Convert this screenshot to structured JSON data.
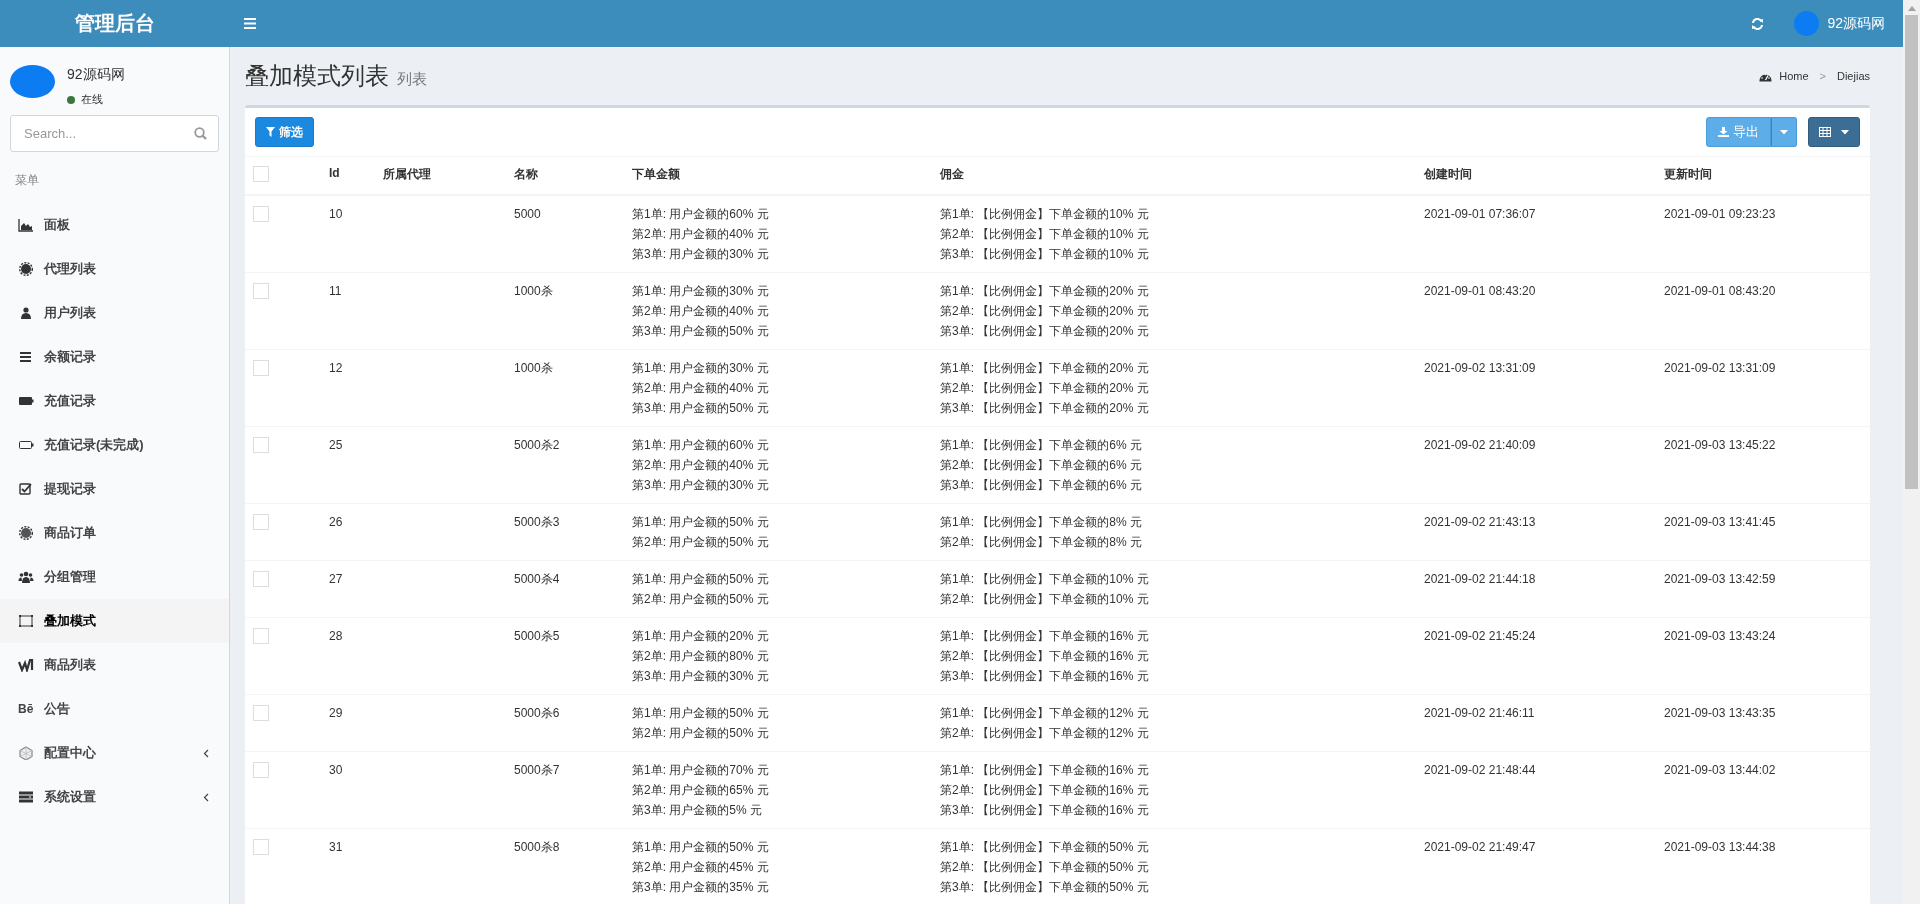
{
  "header": {
    "brand": "管理后台",
    "user_name": "92源码网"
  },
  "sidebar": {
    "user": {
      "name": "92源码网",
      "status": "在线"
    },
    "search": {
      "placeholder": "Search..."
    },
    "section_label": "菜单",
    "items": [
      {
        "label": "面板",
        "kind": "link",
        "selected": false
      },
      {
        "label": "代理列表",
        "kind": "link",
        "selected": false
      },
      {
        "label": "用户列表",
        "kind": "link",
        "selected": false
      },
      {
        "label": "余额记录",
        "kind": "link",
        "selected": false
      },
      {
        "label": "充值记录",
        "kind": "link",
        "selected": false
      },
      {
        "label": "充值记录(未完成)",
        "kind": "link",
        "selected": false
      },
      {
        "label": "提现记录",
        "kind": "link",
        "selected": false
      },
      {
        "label": "商品订单",
        "kind": "link",
        "selected": false
      },
      {
        "label": "分组管理",
        "kind": "link",
        "selected": false
      },
      {
        "label": "叠加模式",
        "kind": "link",
        "selected": true
      },
      {
        "label": "商品列表",
        "kind": "link",
        "selected": false
      },
      {
        "label": "公告",
        "kind": "link",
        "selected": false,
        "glyph": "Bē"
      },
      {
        "label": "配置中心",
        "kind": "submenu",
        "selected": false
      },
      {
        "label": "系统设置",
        "kind": "submenu",
        "selected": false
      }
    ]
  },
  "page": {
    "title": "叠加模式列表",
    "subtitle": "列表",
    "breadcrumb": [
      "Home",
      ">",
      "Diejias"
    ]
  },
  "toolbar": {
    "filter_button": "筛选",
    "export_button": "导出"
  },
  "table": {
    "columns": [
      "Id",
      "所属代理",
      "名称",
      "下单金额",
      "佣金",
      "创建时间",
      "更新时间"
    ],
    "header_checked": false,
    "rows": [
      {
        "checked": false,
        "id": "10",
        "name": "5000",
        "order_amount": [
          "第1单: 用户金额的60% 元",
          "第2单: 用户金额的40% 元",
          "第3单: 用户金额的30% 元"
        ],
        "commission": [
          "第1单: 【比例佣金】下单金额的10% 元",
          "第2单: 【比例佣金】下单金额的10% 元",
          "第3单: 【比例佣金】下单金额的10% 元"
        ],
        "created": "2021-09-01 07:36:07",
        "updated": "2021-09-01 09:23:23"
      },
      {
        "checked": false,
        "id": "11",
        "name": "1000杀",
        "order_amount": [
          "第1单: 用户金额的30% 元",
          "第2单: 用户金额的40% 元",
          "第3单: 用户金额的50% 元"
        ],
        "commission": [
          "第1单: 【比例佣金】下单金额的20% 元",
          "第2单: 【比例佣金】下单金额的20% 元",
          "第3单: 【比例佣金】下单金额的20% 元"
        ],
        "created": "2021-09-01 08:43:20",
        "updated": "2021-09-01 08:43:20"
      },
      {
        "checked": false,
        "id": "12",
        "name": "1000杀",
        "order_amount": [
          "第1单: 用户金额的30% 元",
          "第2单: 用户金额的40% 元",
          "第3单: 用户金额的50% 元"
        ],
        "commission": [
          "第1单: 【比例佣金】下单金额的20% 元",
          "第2单: 【比例佣金】下单金额的20% 元",
          "第3单: 【比例佣金】下单金额的20% 元"
        ],
        "created": "2021-09-02 13:31:09",
        "updated": "2021-09-02 13:31:09"
      },
      {
        "checked": false,
        "id": "25",
        "name": "5000杀2",
        "order_amount": [
          "第1单: 用户金额的60% 元",
          "第2单: 用户金额的40% 元",
          "第3单: 用户金额的30% 元"
        ],
        "commission": [
          "第1单: 【比例佣金】下单金额的6% 元",
          "第2单: 【比例佣金】下单金额的6% 元",
          "第3单: 【比例佣金】下单金额的6% 元"
        ],
        "created": "2021-09-02 21:40:09",
        "updated": "2021-09-03 13:45:22"
      },
      {
        "checked": false,
        "id": "26",
        "name": "5000杀3",
        "order_amount": [
          "第1单: 用户金额的50% 元",
          "第2单: 用户金额的50% 元"
        ],
        "commission": [
          "第1单: 【比例佣金】下单金额的8% 元",
          "第2单: 【比例佣金】下单金额的8% 元"
        ],
        "created": "2021-09-02 21:43:13",
        "updated": "2021-09-03 13:41:45"
      },
      {
        "checked": false,
        "id": "27",
        "name": "5000杀4",
        "order_amount": [
          "第1单: 用户金额的50% 元",
          "第2单: 用户金额的50% 元"
        ],
        "commission": [
          "第1单: 【比例佣金】下单金额的10% 元",
          "第2单: 【比例佣金】下单金额的10% 元"
        ],
        "created": "2021-09-02 21:44:18",
        "updated": "2021-09-03 13:42:59"
      },
      {
        "checked": false,
        "id": "28",
        "name": "5000杀5",
        "order_amount": [
          "第1单: 用户金额的20% 元",
          "第2单: 用户金额的80% 元",
          "第3单: 用户金额的30% 元"
        ],
        "commission": [
          "第1单: 【比例佣金】下单金额的16% 元",
          "第2单: 【比例佣金】下单金额的16% 元",
          "第3单: 【比例佣金】下单金额的16% 元"
        ],
        "created": "2021-09-02 21:45:24",
        "updated": "2021-09-03 13:43:24"
      },
      {
        "checked": false,
        "id": "29",
        "name": "5000杀6",
        "order_amount": [
          "第1单: 用户金额的50% 元",
          "第2单: 用户金额的50% 元"
        ],
        "commission": [
          "第1单: 【比例佣金】下单金额的12% 元",
          "第2单: 【比例佣金】下单金额的12% 元"
        ],
        "created": "2021-09-02 21:46:11",
        "updated": "2021-09-03 13:43:35"
      },
      {
        "checked": false,
        "id": "30",
        "name": "5000杀7",
        "order_amount": [
          "第1单: 用户金额的70% 元",
          "第2单: 用户金额的65% 元",
          "第3单: 用户金额的5% 元"
        ],
        "commission": [
          "第1单: 【比例佣金】下单金额的16% 元",
          "第2单: 【比例佣金】下单金额的16% 元",
          "第3单: 【比例佣金】下单金额的16% 元"
        ],
        "created": "2021-09-02 21:48:44",
        "updated": "2021-09-03 13:44:02"
      },
      {
        "checked": false,
        "id": "31",
        "name": "5000杀8",
        "order_amount": [
          "第1单: 用户金额的50% 元",
          "第2单: 用户金额的45% 元",
          "第3单: 用户金额的35% 元"
        ],
        "commission": [
          "第1单: 【比例佣金】下单金额的50% 元",
          "第2单: 【比例佣金】下单金额的50% 元",
          "第3单: 【比例佣金】下单金额的50% 元"
        ],
        "created": "2021-09-02 21:49:47",
        "updated": "2021-09-03 13:44:38"
      }
    ]
  }
}
